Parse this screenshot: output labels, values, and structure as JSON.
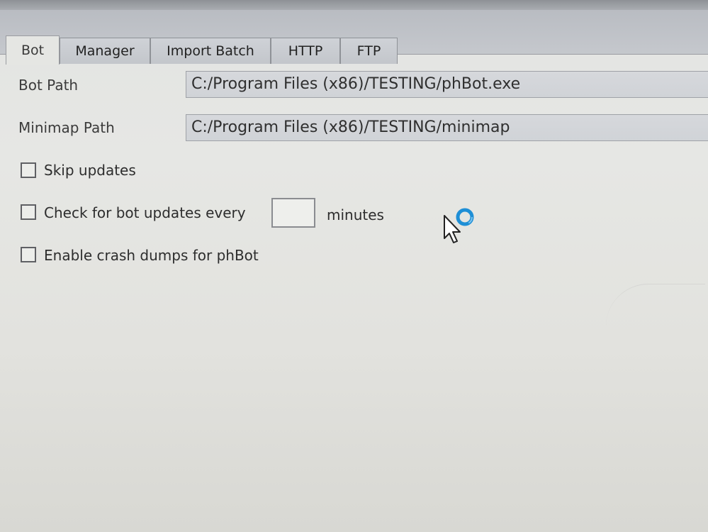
{
  "tabs": [
    {
      "label": "Bot",
      "active": true
    },
    {
      "label": "Manager",
      "active": false
    },
    {
      "label": "Import Batch",
      "active": false
    },
    {
      "label": "HTTP",
      "active": false
    },
    {
      "label": "FTP",
      "active": false
    }
  ],
  "bot_path": {
    "label": "Bot Path",
    "value": "C:/Program Files (x86)/TESTING/phBot.exe"
  },
  "minimap_path": {
    "label": "Minimap Path",
    "value": "C:/Program Files (x86)/TESTING/minimap"
  },
  "options": {
    "skip_updates": {
      "label": "Skip updates",
      "checked": false
    },
    "check_updates": {
      "label": "Check for bot updates every",
      "checked": false,
      "interval_value": "",
      "unit": "minutes"
    },
    "crash_dumps": {
      "label": "Enable crash dumps for phBot",
      "checked": false
    }
  },
  "cursor": {
    "icon": "busy-pointer-icon",
    "spinner_color": "#1e8fd6"
  }
}
